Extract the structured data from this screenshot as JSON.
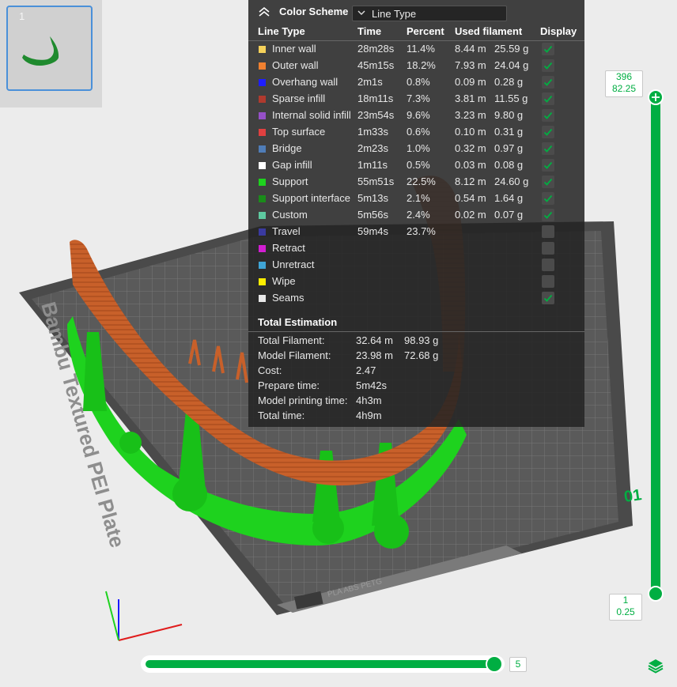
{
  "thumbnail": {
    "number": "1"
  },
  "scene": {
    "plate_label": "Bambu Textured PEI Plate",
    "plate_sub_label": "PLA ABS PETG",
    "plate_number": "01"
  },
  "legend": {
    "title": "Color Scheme",
    "selected_view": "Line Type",
    "headers": {
      "type": "Line Type",
      "time": "Time",
      "percent": "Percent",
      "filament": "Used filament",
      "display": "Display"
    },
    "rows": [
      {
        "name": "Inner wall",
        "color": "#f5d15a",
        "time": "28m28s",
        "percent": "11.4%",
        "length": "8.44 m",
        "weight": "25.59 g",
        "display": true
      },
      {
        "name": "Outer wall",
        "color": "#f08030",
        "time": "45m15s",
        "percent": "18.2%",
        "length": "7.93 m",
        "weight": "24.04 g",
        "display": true
      },
      {
        "name": "Overhang wall",
        "color": "#1e1eff",
        "time": "2m1s",
        "percent": "0.8%",
        "length": "0.09 m",
        "weight": "0.28 g",
        "display": true
      },
      {
        "name": "Sparse infill",
        "color": "#b03a2e",
        "time": "18m11s",
        "percent": "7.3%",
        "length": "3.81 m",
        "weight": "11.55 g",
        "display": true
      },
      {
        "name": "Internal solid infill",
        "color": "#9650c8",
        "time": "23m54s",
        "percent": "9.6%",
        "length": "3.23 m",
        "weight": "9.80 g",
        "display": true
      },
      {
        "name": "Top surface",
        "color": "#e04040",
        "time": "1m33s",
        "percent": "0.6%",
        "length": "0.10 m",
        "weight": "0.31 g",
        "display": true
      },
      {
        "name": "Bridge",
        "color": "#4f7db8",
        "time": "2m23s",
        "percent": "1.0%",
        "length": "0.32 m",
        "weight": "0.97 g",
        "display": true
      },
      {
        "name": "Gap infill",
        "color": "#ffffff",
        "time": "1m11s",
        "percent": "0.5%",
        "length": "0.03 m",
        "weight": "0.08 g",
        "display": true
      },
      {
        "name": "Support",
        "color": "#1ed21e",
        "time": "55m51s",
        "percent": "22.5%",
        "length": "8.12 m",
        "weight": "24.60 g",
        "display": true
      },
      {
        "name": "Support interface",
        "color": "#1a8c1a",
        "time": "5m13s",
        "percent": "2.1%",
        "length": "0.54 m",
        "weight": "1.64 g",
        "display": true
      },
      {
        "name": "Custom",
        "color": "#5ec9a0",
        "time": "5m56s",
        "percent": "2.4%",
        "length": "0.02 m",
        "weight": "0.07 g",
        "display": true
      },
      {
        "name": "Travel",
        "color": "#3a3aa0",
        "time": "59m4s",
        "percent": "23.7%",
        "length": "",
        "weight": "",
        "display": false
      },
      {
        "name": "Retract",
        "color": "#d21ed2",
        "time": "",
        "percent": "",
        "length": "",
        "weight": "",
        "display": false
      },
      {
        "name": "Unretract",
        "color": "#3fa5d6",
        "time": "",
        "percent": "",
        "length": "",
        "weight": "",
        "display": false
      },
      {
        "name": "Wipe",
        "color": "#ffee00",
        "time": "",
        "percent": "",
        "length": "",
        "weight": "",
        "display": false
      },
      {
        "name": "Seams",
        "color": "#e8e8e8",
        "time": "",
        "percent": "",
        "length": "",
        "weight": "",
        "display": true
      }
    ]
  },
  "totals": {
    "title": "Total Estimation",
    "rows": [
      {
        "label": "Total Filament:",
        "value": "32.64 m",
        "value2": "98.93 g"
      },
      {
        "label": "Model Filament:",
        "value": "23.98 m",
        "value2": "72.68 g"
      },
      {
        "label": "Cost:",
        "value": "2.47",
        "value2": ""
      },
      {
        "label": "Prepare time:",
        "value": "5m42s",
        "value2": ""
      },
      {
        "label": "Model printing time:",
        "value": "4h3m",
        "value2": ""
      },
      {
        "label": "Total time:",
        "value": "4h9m",
        "value2": ""
      }
    ]
  },
  "layer_slider": {
    "top_layer": "396",
    "top_height": "82.25",
    "bottom_layer": "1",
    "bottom_height": "0.25"
  },
  "move_slider": {
    "value": "5"
  },
  "colors": {
    "accent": "#00ae42",
    "plate": "#5a5a5a",
    "model": "#c8602a",
    "support": "#1ed21e"
  }
}
